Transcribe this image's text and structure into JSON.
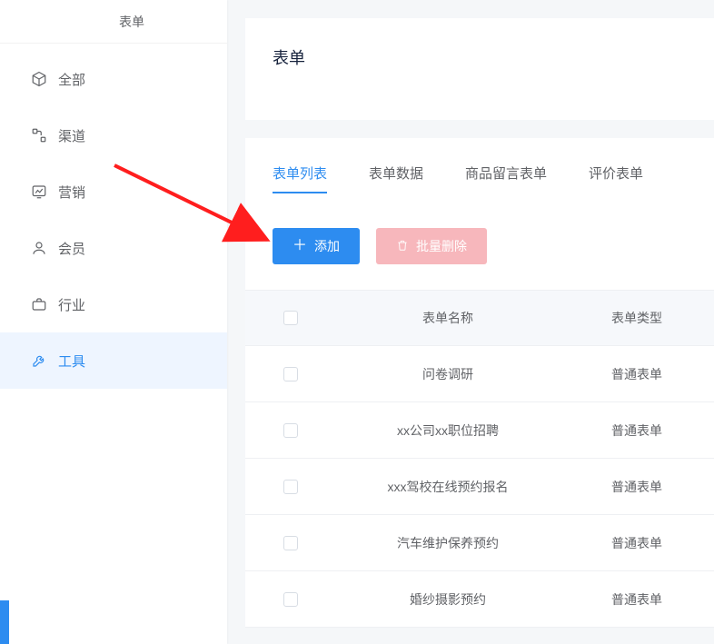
{
  "top_tab": "表单",
  "sidebar": {
    "items": [
      {
        "label": "全部"
      },
      {
        "label": "渠道"
      },
      {
        "label": "营销"
      },
      {
        "label": "会员"
      },
      {
        "label": "行业"
      },
      {
        "label": "工具"
      }
    ],
    "active_index": 5
  },
  "page_title": "表单",
  "tabs": {
    "items": [
      {
        "label": "表单列表"
      },
      {
        "label": "表单数据"
      },
      {
        "label": "商品留言表单"
      },
      {
        "label": "评价表单"
      }
    ],
    "active_index": 0
  },
  "actions": {
    "add_label": "添加",
    "bulk_delete_label": "批量删除"
  },
  "table": {
    "columns": {
      "name": "表单名称",
      "type": "表单类型"
    },
    "rows": [
      {
        "name": "问卷调研",
        "type": "普通表单"
      },
      {
        "name": "xx公司xx职位招聘",
        "type": "普通表单"
      },
      {
        "name": "xxx驾校在线预约报名",
        "type": "普通表单"
      },
      {
        "name": "汽车维护保养预约",
        "type": "普通表单"
      },
      {
        "name": "婚纱摄影预约",
        "type": "普通表单"
      }
    ]
  }
}
